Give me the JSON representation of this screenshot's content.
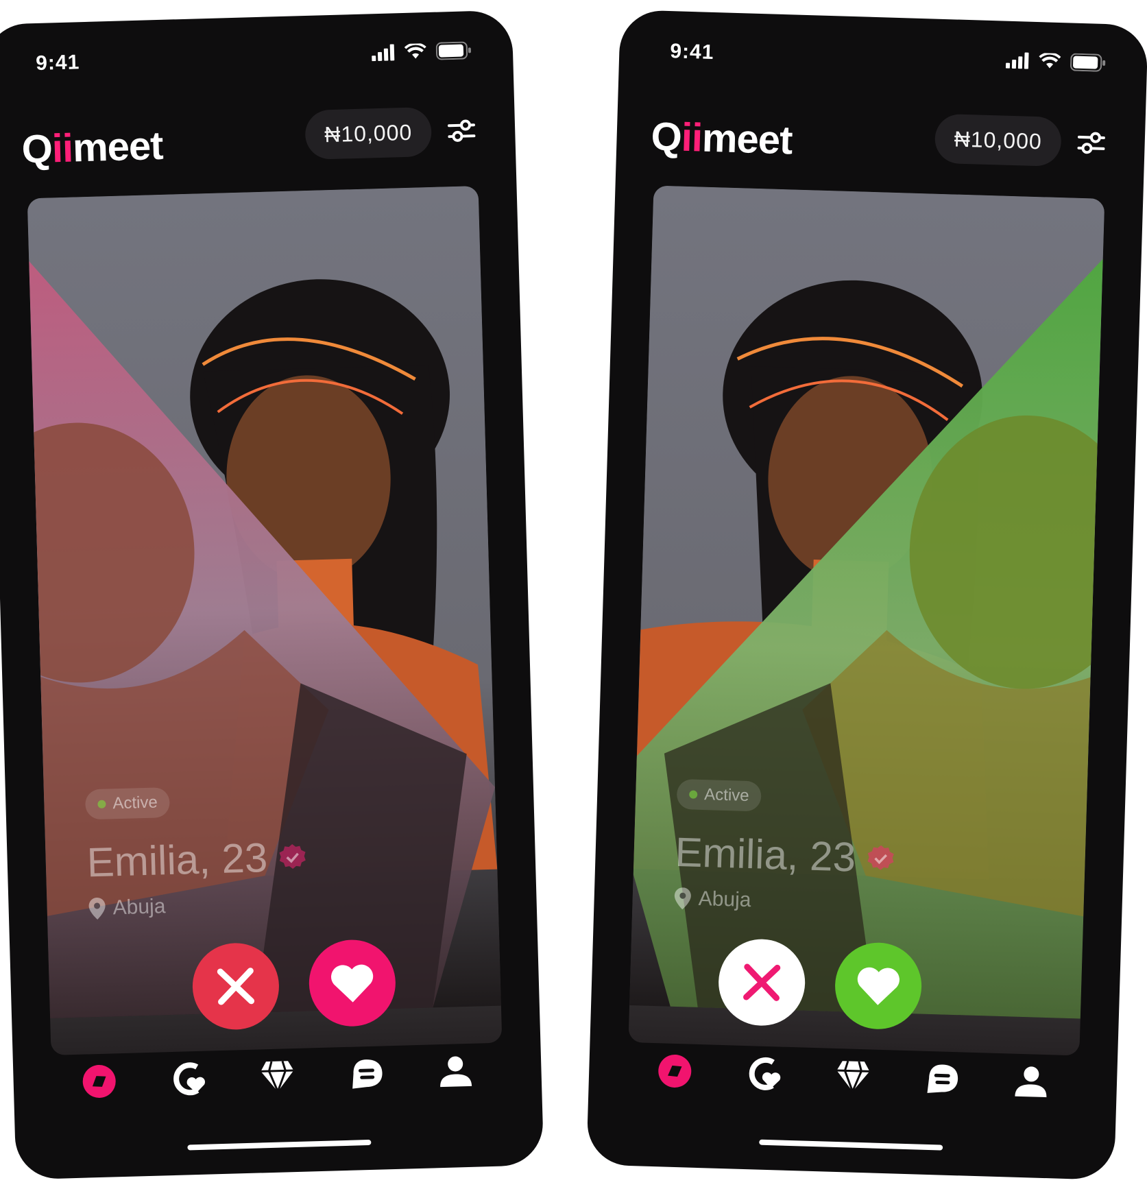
{
  "phones": [
    {
      "status": {
        "time": "9:41"
      },
      "logo": {
        "text_pre": "Q",
        "text_accent": "ii",
        "text_post": "meet"
      },
      "wallet": {
        "balance": "₦10,000"
      },
      "profile": {
        "status": "Active",
        "name_age": "Emilia, 23",
        "location": "Abuja"
      },
      "swipe_tint": "pink",
      "actions": {
        "reject_style": "red-filled",
        "like_style": "pink-filled"
      }
    },
    {
      "status": {
        "time": "9:41"
      },
      "logo": {
        "text_pre": "Q",
        "text_accent": "ii",
        "text_post": "meet"
      },
      "wallet": {
        "balance": "₦10,000"
      },
      "profile": {
        "status": "Active",
        "name_age": "Emilia, 23",
        "location": "Abuja"
      },
      "swipe_tint": "green",
      "actions": {
        "reject_style": "white-filled",
        "like_style": "green-filled"
      }
    }
  ],
  "colors": {
    "brand_pink": "#ff1f78",
    "reject_red": "#e5344a",
    "like_green": "#5ec62b",
    "background": "#0e0d0e"
  },
  "tabs": [
    "discover-icon",
    "matches-icon",
    "premium-diamond-icon",
    "chat-icon",
    "profile-icon"
  ]
}
